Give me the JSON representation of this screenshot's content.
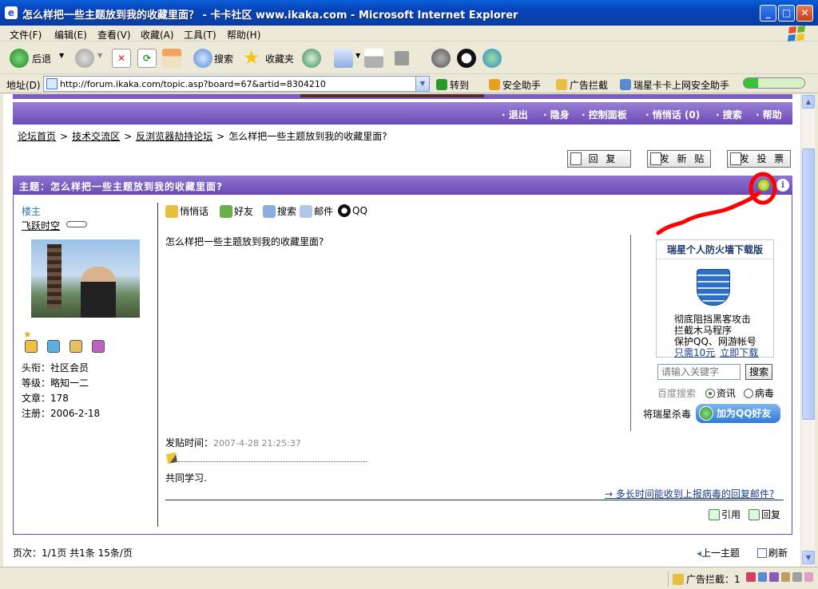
{
  "window": {
    "title": "怎么样把一些主题放到我的收藏里面？ - 卡卡社区 www.ikaka.com - Microsoft Internet Explorer",
    "minimize": "_",
    "maximize": "□",
    "close": "✕"
  },
  "menu": [
    "文件(F)",
    "编辑(E)",
    "查看(V)",
    "收藏(A)",
    "工具(T)",
    "帮助(H)"
  ],
  "toolbar": {
    "back": "后退",
    "search": "搜索",
    "favorites": "收藏夹"
  },
  "address": {
    "label": "地址(D)",
    "url": "http://forum.ikaka.com/topic.asp?board=67&artid=8304210",
    "go": "转到",
    "links": [
      "安全助手",
      "广告拦截",
      "瑞星卡卡上网安全助手"
    ]
  },
  "forum_nav": [
    "· 退出",
    "· 隐身",
    "· 控制面板",
    "· 悄悄话 (0)",
    "· 搜索",
    "· 帮助"
  ],
  "breadcrumb": {
    "items": [
      "论坛首页",
      "技术交流区",
      "反浏览器劫持论坛"
    ],
    "current": "怎么样把一些主题放到我的收藏里面?"
  },
  "buttons": {
    "reply": "回 复",
    "new_post": "发 新 贴",
    "new_poll": "发 投 票"
  },
  "thread": {
    "title": "主题：怎么样把一些主题放到我的收藏里面?",
    "info_icon": "i"
  },
  "author": {
    "role": "楼主",
    "name": "飞跃时空",
    "title_line": "头衔：社区会员",
    "level_line": "等级：略知一二",
    "posts_line": "文章：178",
    "reg_line": "注册：2006-2-18"
  },
  "post_tools": [
    "悄悄话",
    "好友",
    "搜索",
    "邮件",
    "QQ"
  ],
  "post": {
    "body": "怎么样把一些主题放到我的收藏里面?",
    "time_label": "发贴时间：",
    "time_value": "2007-4-28 21:25:37",
    "signature": "共同学习.",
    "related_link": "→ 多长时间能收到上报病毒的回复邮件?"
  },
  "actions": {
    "quote": "引用",
    "reply": "回复"
  },
  "ad": {
    "title": "瑞星个人防火墙下载版",
    "line1": "彻底阻挡黑客攻击",
    "line2": "拦截木马程序",
    "line3": "保护QQ、网游帐号",
    "price_link": "只需10元",
    "download_link": "立即下载"
  },
  "search": {
    "placeholder": "请输入关键字",
    "button": "搜索",
    "provider": "百度搜索",
    "option1": "资讯",
    "option2": "病毒"
  },
  "qq": {
    "prefix": "将瑞星杀毒",
    "button": "加为QQ好友"
  },
  "pager": {
    "text": "页次：1/1页 共1条 15条/页",
    "prev_topic": "上一主题",
    "refresh": "刷新"
  },
  "statusbar": {
    "adblock": "广告拦截：1"
  },
  "colors": {
    "forum_purple": "#6c4ab8",
    "annotation_red": "#ff0000",
    "xp_blue": "#0a3fa6"
  }
}
